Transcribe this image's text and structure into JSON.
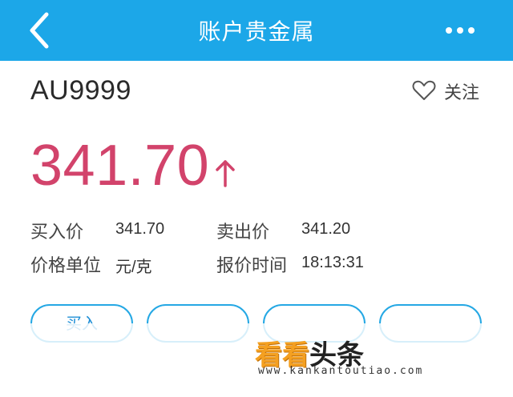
{
  "nav": {
    "title": "账户贵金属",
    "back_icon": "chevron-left-icon",
    "more_icon": "more-horizontal-icon",
    "bg_color": "#1ca7e8"
  },
  "instrument": {
    "symbol": "AU9999",
    "follow_label": "关注",
    "follow_icon": "heart-outline-icon"
  },
  "price": {
    "value": "341.70",
    "trend_icon": "arrow-up-icon",
    "color": "#d2436b"
  },
  "details": {
    "buy_label": "买入价",
    "buy_value": "341.70",
    "sell_label": "卖出价",
    "sell_value": "341.20",
    "unit_label": "价格单位",
    "unit_value": "元/克",
    "time_label": "报价时间",
    "time_value": "18:13:31"
  },
  "actions": {
    "buy_label": "买入"
  },
  "watermark": {
    "part1": "看看",
    "part2": "头条",
    "url": "www.kankantoutiao.com"
  }
}
